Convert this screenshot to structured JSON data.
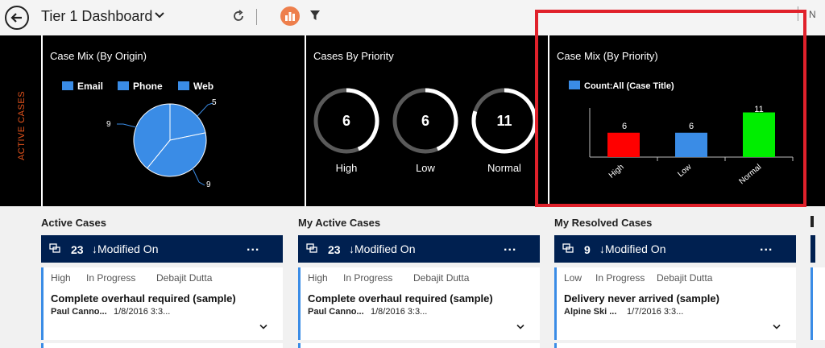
{
  "header": {
    "title": "Tier 1 Dashboard",
    "more_text": "N"
  },
  "icons": [
    "back-arrow-icon",
    "chevron-down-icon",
    "refresh-icon",
    "visualization-icon",
    "filter-icon",
    "queue-icon",
    "ellipsis-icon"
  ],
  "stream_label": "ACTIVE CASES",
  "colors": {
    "accent_dark_blue": "#002050",
    "series_blue": "#3a8ce6",
    "bar_high": "#ff0000",
    "bar_low": "#3a8ce6",
    "bar_normal": "#00ee00",
    "highlight_box": "#e0212b",
    "stream_label": "#e5531c"
  },
  "charts": {
    "origin": {
      "title": "Case Mix (By Origin)",
      "legend": [
        "Email",
        "Phone",
        "Web"
      ]
    },
    "priority_gauges": {
      "title": "Cases By Priority",
      "items": [
        {
          "label": "High",
          "value": "6"
        },
        {
          "label": "Low",
          "value": "6"
        },
        {
          "label": "Normal",
          "value": "11"
        }
      ]
    },
    "priority_bars": {
      "title": "Case Mix (By Priority)",
      "legend": "Count:All (Case Title)"
    }
  },
  "chart_data": [
    {
      "type": "pie",
      "title": "Case Mix (By Origin)",
      "categories": [
        "Email",
        "Phone",
        "Web"
      ],
      "values": [
        9,
        9,
        5
      ],
      "labels": [
        "9",
        "9",
        "5"
      ]
    },
    {
      "type": "bar",
      "title": "Cases By Priority",
      "categories": [
        "High",
        "Low",
        "Normal"
      ],
      "values": [
        6,
        6,
        11
      ]
    },
    {
      "type": "bar",
      "title": "Case Mix (By Priority)",
      "categories": [
        "High",
        "Low",
        "Normal"
      ],
      "series": [
        {
          "name": "Count:All (Case Title)",
          "values": [
            6,
            6,
            11
          ]
        }
      ],
      "value_labels": [
        "6",
        "6",
        "11"
      ],
      "ylim": [
        0,
        12
      ]
    }
  ],
  "streams": [
    {
      "title": "Active Cases",
      "count": "23",
      "sort": "↓Modified On",
      "more": "...",
      "card": {
        "priority": "High",
        "status": "In Progress",
        "owner": "Debajit Dutta",
        "title": "Complete overhaul required (sample)",
        "customer": "Paul Canno...",
        "date": "1/8/2016 3:3..."
      }
    },
    {
      "title": "My Active Cases",
      "count": "23",
      "sort": "↓Modified On",
      "more": "...",
      "card": {
        "priority": "High",
        "status": "In Progress",
        "owner": "Debajit Dutta",
        "title": "Complete overhaul required (sample)",
        "customer": "Paul Canno...",
        "date": "1/8/2016 3:3..."
      }
    },
    {
      "title": "My Resolved Cases",
      "count": "9",
      "sort": "↓Modified On",
      "more": "...",
      "card": {
        "priority": "Low",
        "status": "In Progress",
        "owner": "Debajit Dutta",
        "title": "Delivery never arrived (sample)",
        "customer": "Alpine Ski ...",
        "date": "1/7/2016 3:3..."
      }
    }
  ]
}
